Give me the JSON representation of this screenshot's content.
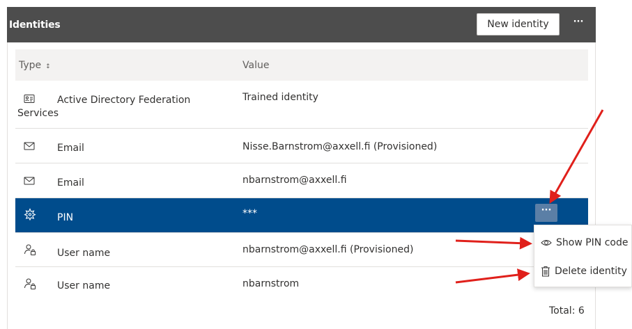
{
  "header": {
    "title": "Identities",
    "new_button": "New identity",
    "more_label": "···"
  },
  "table": {
    "columns": {
      "type": "Type",
      "sort_indicator": "↕",
      "value": "Value"
    },
    "rows": [
      {
        "icon": "id-card-icon",
        "type_line1": "Active Directory Federation",
        "type_line2": "Services",
        "value": "Trained identity"
      },
      {
        "icon": "mail-icon",
        "type": "Email",
        "value": "Nisse.Barnstrom@axxell.fi (Provisioned)"
      },
      {
        "icon": "mail-icon",
        "type": "Email",
        "value": "nbarnstrom@axxell.fi"
      },
      {
        "icon": "pin-icon",
        "type": "PIN",
        "value": "***",
        "selected": true
      },
      {
        "icon": "user-lock-icon",
        "type": "User name",
        "value": "nbarnstrom@axxell.fi (Provisioned)"
      },
      {
        "icon": "user-lock-icon",
        "type": "User name",
        "value": "nbarnstrom"
      }
    ],
    "row_more_label": "···",
    "total": "Total: 6"
  },
  "context_menu": {
    "items": [
      {
        "icon": "eye-icon",
        "label": "Show PIN code"
      },
      {
        "icon": "trash-icon",
        "label": "Delete identity"
      }
    ]
  },
  "colors": {
    "header_bg": "#4d4d4d",
    "selected_row": "#004c8c",
    "arrow": "#e0201b"
  }
}
